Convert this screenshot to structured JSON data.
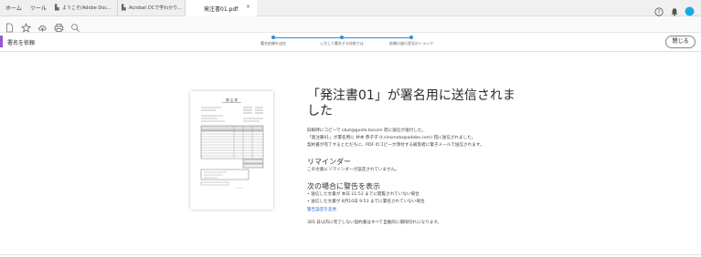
{
  "menu": [
    "ホーム",
    "ツール"
  ],
  "tabs": [
    {
      "label": "ようこそ(Adobe Doc..."
    },
    {
      "label": "Acrobat DCで学わかり..."
    }
  ],
  "active_tab": {
    "label": "発注書01.pdf",
    "close": "×"
  },
  "topright": {
    "help_icon": "help-icon",
    "bell_icon": "bell-icon",
    "avatar_color": "#1ea7e6"
  },
  "subbar": {
    "title": "署名を依頼",
    "close_label": "閉じる",
    "steps": [
      "署名依頼を送信",
      "入力して署名する技術では",
      "依頼の進行状況のトラック"
    ],
    "accent": "#9b59c9",
    "step_color": "#2c8fd6"
  },
  "main": {
    "title": "「発注書01」が署名用に送信されました",
    "info_lines": [
      "旧紙時にコピーで cbut@guide.bocom 宛に送信が送付した。",
      "「発注書01」が署名用に 井本 恭子子 (t.sinsmoto@adobe.com) 宛に送信されました。",
      "契約書が完了するとただちに、PDF のコピーが添付する被旅者に電子メールで送信されます。"
    ],
    "reminder_heading": "リマインダー",
    "reminder_text": "この文書にリマインダーが設定されていません。",
    "warn_heading": "次の場合に警告を表示",
    "warn_items": [
      "• 送信した文書が 本日 21:53 までに閲覧されていない場合",
      "• 送信した文書が 8月10日 9:53 までに署名されていない場合"
    ],
    "warn_link": "警告設定を変更",
    "footer_note": "365 日以内に完了しない契約書はすべて自動的に期限切れになります。"
  },
  "thumbnail": {
    "header": "発 注 書"
  }
}
